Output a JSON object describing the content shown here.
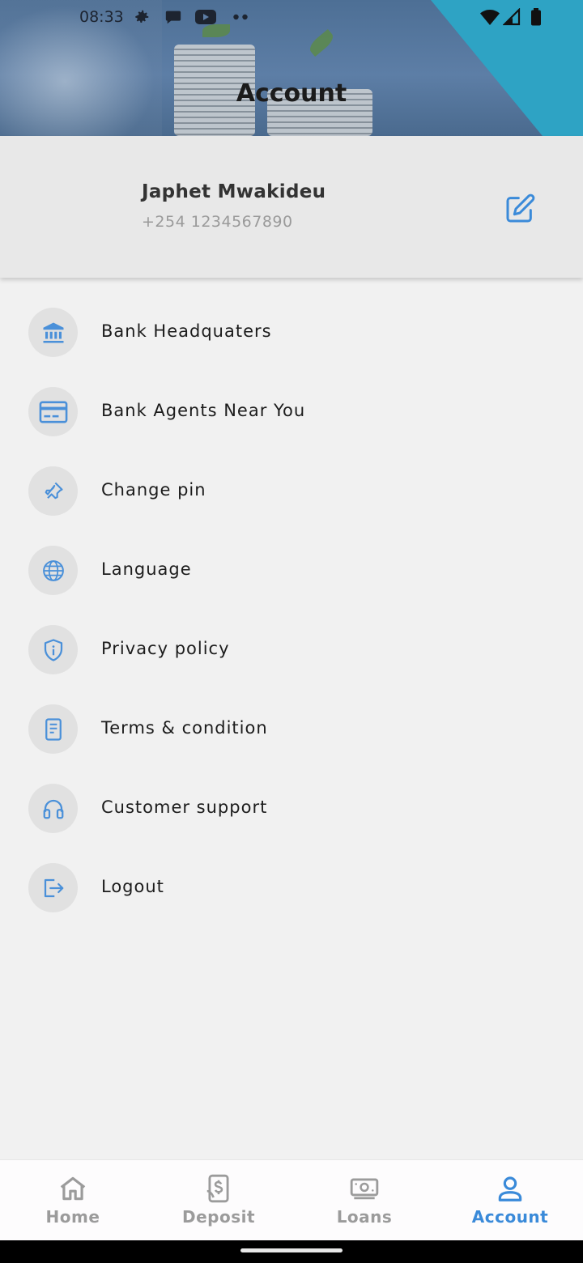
{
  "status_bar": {
    "time": "08:33",
    "icons": [
      "gear-icon",
      "message-icon",
      "youtube-icon",
      "more-dots-icon",
      "wifi-icon",
      "signal-icon",
      "battery-icon"
    ]
  },
  "header": {
    "title": "Account"
  },
  "profile": {
    "name": "Japhet Mwakideu",
    "phone": "+254 1234567890",
    "edit_icon": "edit-icon"
  },
  "menu": [
    {
      "label": "Bank Headquaters",
      "icon": "bank-icon"
    },
    {
      "label": "Bank Agents Near You",
      "icon": "card-icon"
    },
    {
      "label": "Change pin",
      "icon": "pin-icon"
    },
    {
      "label": "Language",
      "icon": "globe-icon"
    },
    {
      "label": "Privacy policy",
      "icon": "shield-icon"
    },
    {
      "label": "Terms & condition",
      "icon": "document-icon"
    },
    {
      "label": "Customer support",
      "icon": "headset-icon"
    },
    {
      "label": "Logout",
      "icon": "logout-icon"
    }
  ],
  "bottom_nav": [
    {
      "label": "Home",
      "icon": "home-icon",
      "active": false
    },
    {
      "label": "Deposit",
      "icon": "deposit-icon",
      "active": false
    },
    {
      "label": "Loans",
      "icon": "cash-icon",
      "active": false
    },
    {
      "label": "Account",
      "icon": "user-icon",
      "active": true
    }
  ],
  "colors": {
    "accent": "#3a8ad9",
    "icon_blue": "#4a90d9",
    "inactive": "#9b9b9b",
    "teal": "#2ea3c4"
  }
}
